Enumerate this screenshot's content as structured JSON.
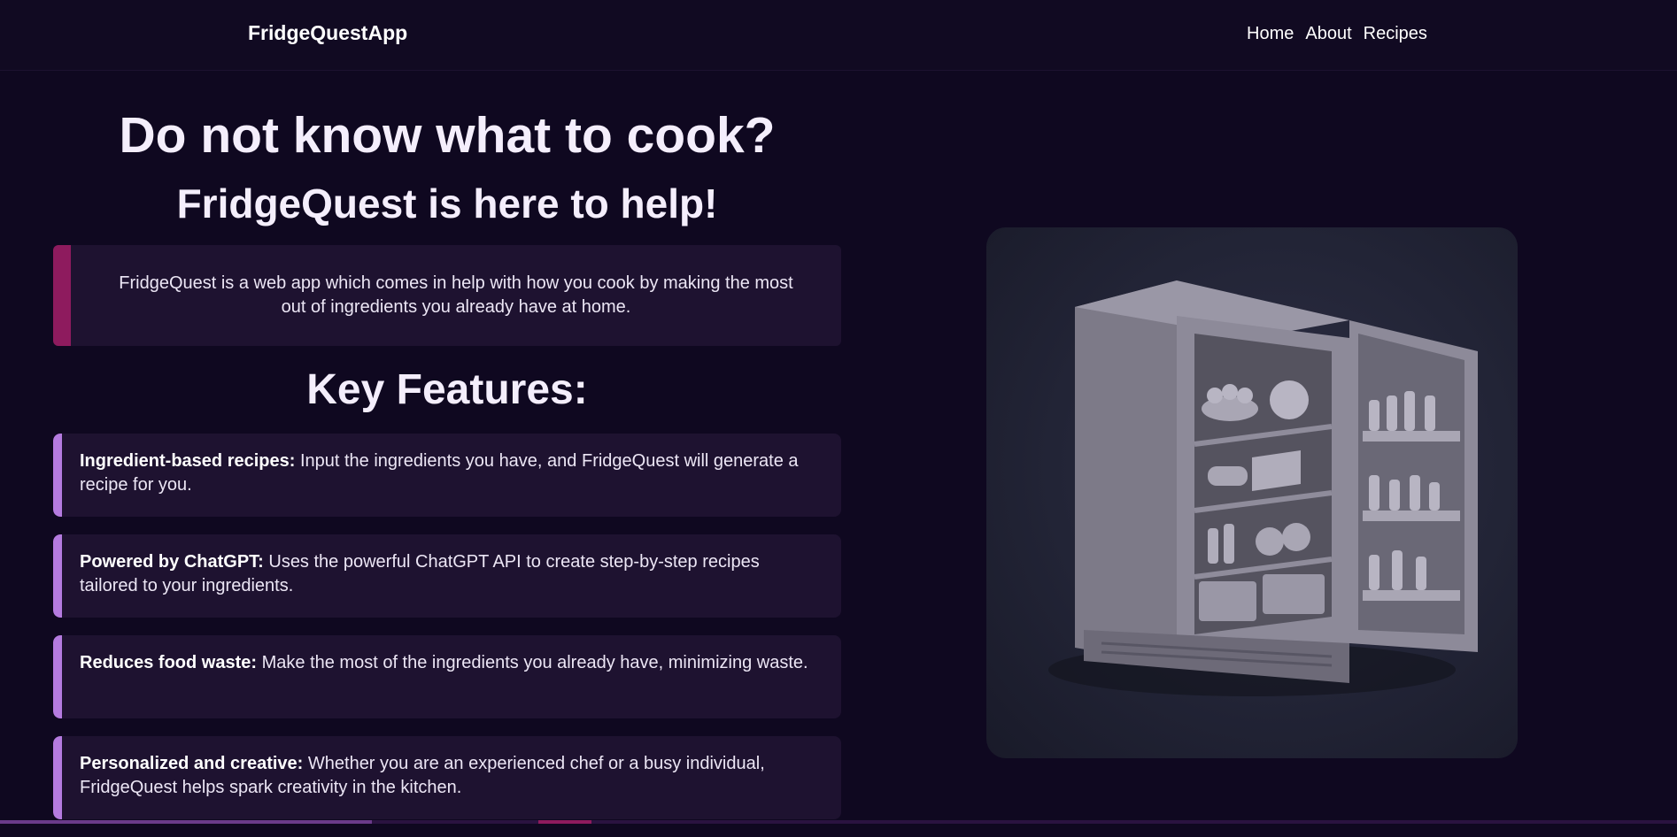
{
  "nav": {
    "brand": "FridgeQuestApp",
    "links": [
      "Home",
      "About",
      "Recipes"
    ]
  },
  "hero": {
    "title": "Do not know what to cook?",
    "subtitle": "FridgeQuest is here to help!",
    "intro": "FridgeQuest is a web app which comes in help with how you cook by making the most out of ingredients you already have at home."
  },
  "features": {
    "heading": "Key Features:",
    "items": [
      {
        "title": "Ingredient-based recipes:",
        "text": " Input the ingredients you have, and FridgeQuest will generate a recipe for you."
      },
      {
        "title": "Powered by ChatGPT:",
        "text": " Uses the powerful ChatGPT API to create step-by-step recipes tailored to your ingredients."
      },
      {
        "title": "Reduces food waste:",
        "text": " Make the most of the ingredients you already have, minimizing waste."
      },
      {
        "title": "Personalized and creative:",
        "text": " Whether you are an experienced chef or a busy individual, FridgeQuest helps spark creativity in the kitchen."
      }
    ]
  },
  "image": {
    "icon": "fridge-illustration"
  },
  "colors": {
    "background": "#0f0820",
    "card": "#1e1230",
    "intro_accent": "#8e1b5e",
    "feature_accent": "#b57be0"
  }
}
